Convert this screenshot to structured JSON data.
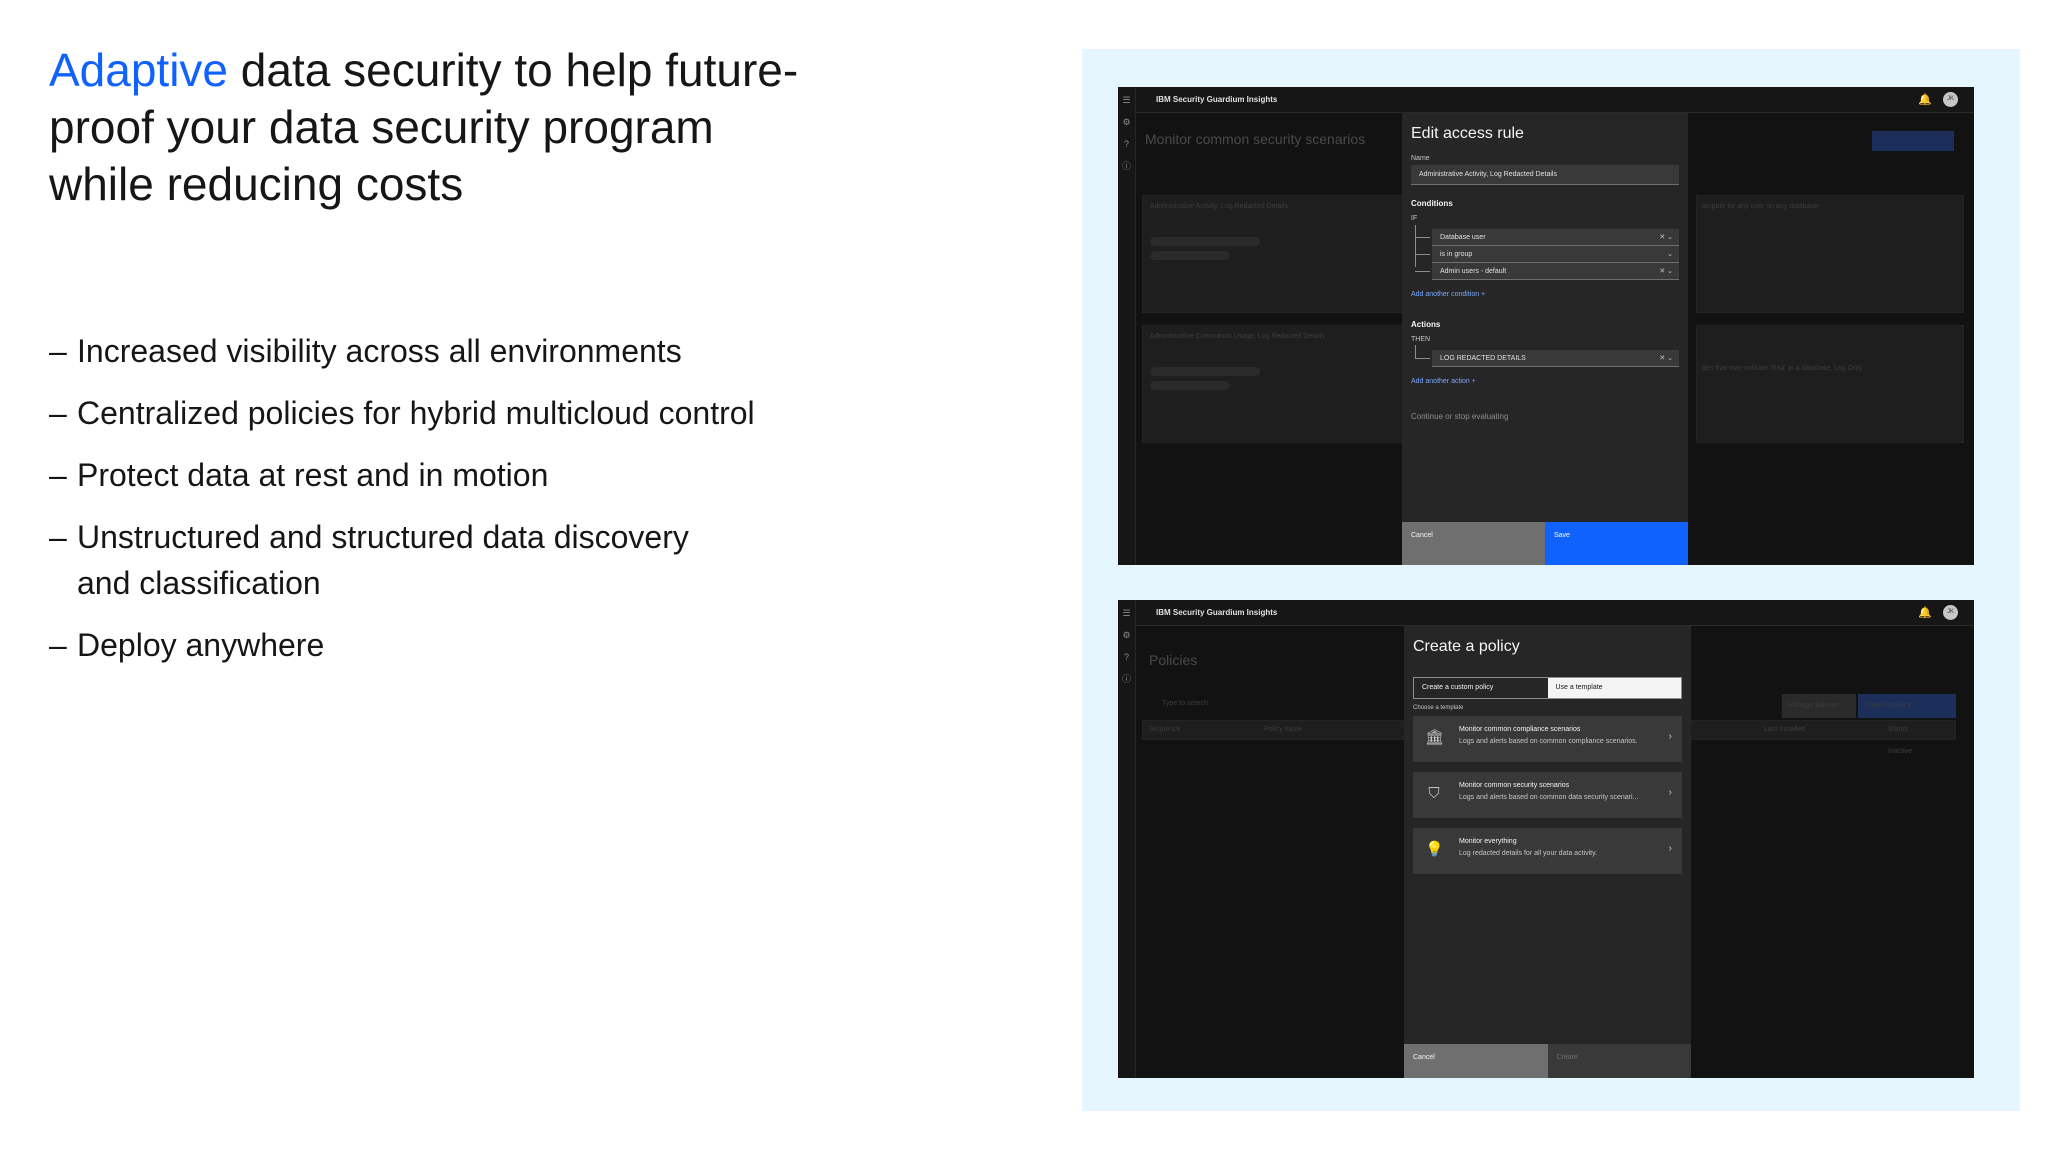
{
  "headline": {
    "accent": "Adaptive",
    "rest": " data security to help future-proof your data security program while reducing costs"
  },
  "bullets": [
    "Increased visibility across all environments",
    "Centralized policies for hybrid multicloud control",
    "Protect data at rest and in motion",
    "Unstructured and structured data discovery and classification",
    "Deploy anywhere"
  ],
  "bullet_dash": "–",
  "colors": {
    "accent": "#0f62fe",
    "panel": "#e5f6ff",
    "app_bg": "#161616",
    "primary_button": "#0f62fe"
  },
  "screen1": {
    "brand": "IBM Security Guardium Insights",
    "avatar": "JK",
    "bg_page_title": "Monitor common security scenarios",
    "bg_rule1": "Administrative Activity, Log Redacted Details",
    "bg_rule2": "Administrative Commands Usage, Log Redacted Details",
    "bg_right1": "ompute for any user on any database",
    "bg_right2": "des that may indicate 'Risk' in a database, Log Only",
    "modal": {
      "title": "Edit access rule",
      "name_label": "Name",
      "name_value": "Administrative Activity, Log Redacted Details",
      "conditions_label": "Conditions",
      "if_label": "IF",
      "conditions": [
        "Database user",
        "is in group",
        "Admin users - default"
      ],
      "add_condition": "Add another condition  +",
      "actions_label": "Actions",
      "then_label": "THEN",
      "action": "LOG REDACTED DETAILS",
      "add_action": "Add another action  +",
      "continue_label": "Continue or stop evaluating",
      "cancel": "Cancel",
      "save": "Save"
    }
  },
  "screen2": {
    "brand": "IBM Security Guardium Insights",
    "avatar": "JK",
    "bg_page_title": "Policies",
    "bg_search": "Type to search",
    "bg_col_sequence": "Sequence",
    "bg_col_policy": "Policy name",
    "bg_col_installed": "Last Installed",
    "bg_col_status": "Status",
    "bg_manage": "Manage policies",
    "bg_create": "Create a policy",
    "bg_status_val": "Inactive",
    "modal": {
      "title": "Create a policy",
      "tab_custom": "Create a custom policy",
      "tab_template": "Use a template",
      "choose_label": "Choose a template",
      "templates": [
        {
          "title": "Monitor common compliance scenarios",
          "desc": "Logs and alerts based on common compliance scenarios.",
          "icon": "building-icon"
        },
        {
          "title": "Monitor common security scenarios",
          "desc": "Logs and alerts based on common data security scenari...",
          "icon": "shield-icon"
        },
        {
          "title": "Monitor everything",
          "desc": "Log redacted details for all your data activity.",
          "icon": "lightbulb-icon"
        }
      ],
      "cancel": "Cancel",
      "create": "Create"
    }
  }
}
